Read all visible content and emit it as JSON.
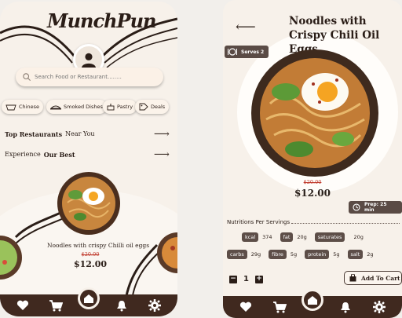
{
  "screen1": {
    "logo": "MunchPun",
    "search": {
      "placeholder": "Search Food or Restaurant........"
    },
    "categories": [
      {
        "label": "Chinese",
        "icon": "noodle-box-icon"
      },
      {
        "label": "Smoked Dishes",
        "icon": "smoked-dish-icon"
      },
      {
        "label": "Pastry",
        "icon": "cake-icon"
      },
      {
        "label": "Deals",
        "icon": "deal-tag-icon"
      }
    ],
    "top_restaurants": {
      "bold": "Top Restaurants",
      "rest": "Near You"
    },
    "experience": {
      "rest": "Experience",
      "bold": "Our Best"
    },
    "featured": {
      "title": "Noodles with crispy Chilli oil eggs",
      "old_price": "$20.00",
      "price": "$12.00"
    },
    "nav": [
      "heart-icon",
      "cart-icon",
      "home-icon",
      "bell-icon",
      "gear-icon"
    ]
  },
  "screen2": {
    "title": "Noodles with Crispy Chili Oil Eggs",
    "serves": "Serves 2",
    "old_price": "$20.00",
    "price": "$12.00",
    "prep": "Prep: 25 min",
    "nutrition_title": "Nutritions Per Servings",
    "nutrition_row1": [
      {
        "label": "kcal",
        "value": "374"
      },
      {
        "label": "fat",
        "value": "20g"
      },
      {
        "label": "saturates",
        "value": "20g"
      }
    ],
    "nutrition_row2": [
      {
        "label": "carbs",
        "value": "29g"
      },
      {
        "label": "fibre",
        "value": "5g"
      },
      {
        "label": "protein",
        "value": "5g"
      },
      {
        "label": "salt",
        "value": "2g"
      }
    ],
    "quantity": "1",
    "add_to_cart": "Add To Cart",
    "nav": [
      "heart-icon",
      "cart-icon",
      "home-icon",
      "bell-icon",
      "gear-icon"
    ]
  },
  "colors": {
    "bg": "#f7f1ea",
    "dark_brown": "#40291f",
    "tag": "#5d4e48",
    "strike": "#c0392b"
  }
}
